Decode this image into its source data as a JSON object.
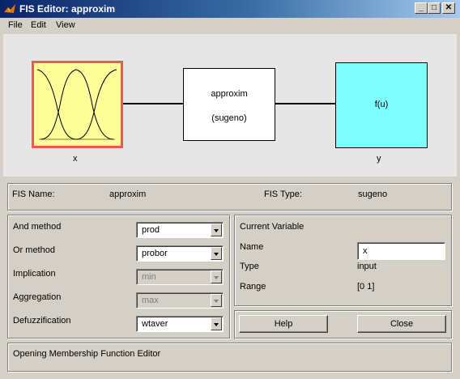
{
  "window": {
    "title": "FIS Editor: approxim"
  },
  "titlebar_buttons": {
    "minimize": "_",
    "maximize": "□",
    "close": "✕"
  },
  "menu": [
    "File",
    "Edit",
    "View"
  ],
  "diagram": {
    "input_label": "x",
    "system_name": "approxim",
    "system_type": "(sugeno)",
    "output_function": "f(u)",
    "output_label": "y",
    "colors": {
      "input_fill": "#ffff99",
      "input_border": "#ef5a50",
      "output_fill": "#80ffff"
    }
  },
  "fis_info": {
    "name_label": "FIS Name:",
    "name_value": "approxim",
    "type_label": "FIS Type:",
    "type_value": "sugeno"
  },
  "methods": {
    "and": {
      "label": "And method",
      "value": "prod",
      "enabled": true
    },
    "or": {
      "label": "Or method",
      "value": "probor",
      "enabled": true
    },
    "implication": {
      "label": "Implication",
      "value": "min",
      "enabled": false
    },
    "aggregation": {
      "label": "Aggregation",
      "value": "max",
      "enabled": false
    },
    "defuzzification": {
      "label": "Defuzzification",
      "value": "wtaver",
      "enabled": true
    }
  },
  "current_variable": {
    "title": "Current Variable",
    "name_label": "Name",
    "name_value": "x",
    "type_label": "Type",
    "type_value": "input",
    "range_label": "Range",
    "range_value": "[0 1]"
  },
  "buttons": {
    "help": "Help",
    "close": "Close"
  },
  "status": {
    "message": "Opening Membership Function Editor"
  }
}
